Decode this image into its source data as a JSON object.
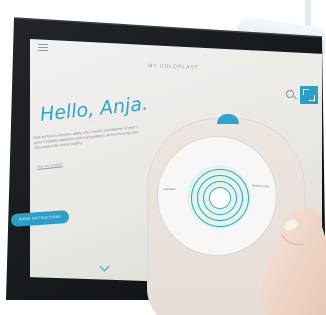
{
  "screen": {
    "brand": "MY COLOPLAST",
    "greeting": "Hello, Anja.",
    "intro_text": "Find out how to prepare, apply, use, remove and dispose of your 1 piece Coloplast appliance and read guidance on how to keep your skin around the stoma healthy.",
    "intro_link": "See our product",
    "know_button": "SHOW INSTRUCTIONS",
    "product": {
      "label_left": "Coloplast",
      "label_right": "SenSura Mio"
    }
  },
  "colors": {
    "accent": "#2a9fc8",
    "bezel": "#15181b",
    "skin": "#f0d9cc"
  }
}
